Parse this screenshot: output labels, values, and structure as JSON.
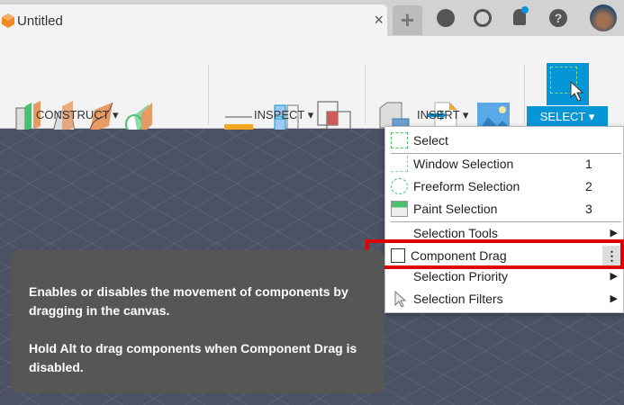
{
  "window": {
    "tab_title": "Untitled",
    "close": "×",
    "new_tab": "+"
  },
  "top_icons": [
    "extensions-icon",
    "history-icon",
    "notifications-icon",
    "help-icon",
    "avatar"
  ],
  "help_glyph": "?",
  "toolbar": {
    "groups": [
      {
        "label": "CONSTRUCT ▾"
      },
      {
        "label": "INSPECT ▾"
      },
      {
        "label": "INSERT ▾"
      },
      {
        "label": "SELECT ▾"
      }
    ]
  },
  "menu": {
    "items": [
      {
        "label": "Select",
        "key": ""
      },
      {
        "label": "Window Selection",
        "key": "1"
      },
      {
        "label": "Freeform Selection",
        "key": "2"
      },
      {
        "label": "Paint Selection",
        "key": "3"
      },
      {
        "label": "Selection Tools",
        "submenu": "▶"
      },
      {
        "label": "Component Drag",
        "checked": false,
        "more": "⋮"
      },
      {
        "label": "Selection Priority",
        "submenu": "▶"
      },
      {
        "label": "Selection Filters",
        "submenu": "▶"
      }
    ]
  },
  "tooltip": {
    "line1": "Enables or disables the movement of components by dragging in the canvas.",
    "line2": "Hold Alt to drag components when Component Drag is disabled."
  },
  "colors": {
    "accent": "#0696d7",
    "highlight": "#e00000",
    "canvas": "#4b5264"
  }
}
